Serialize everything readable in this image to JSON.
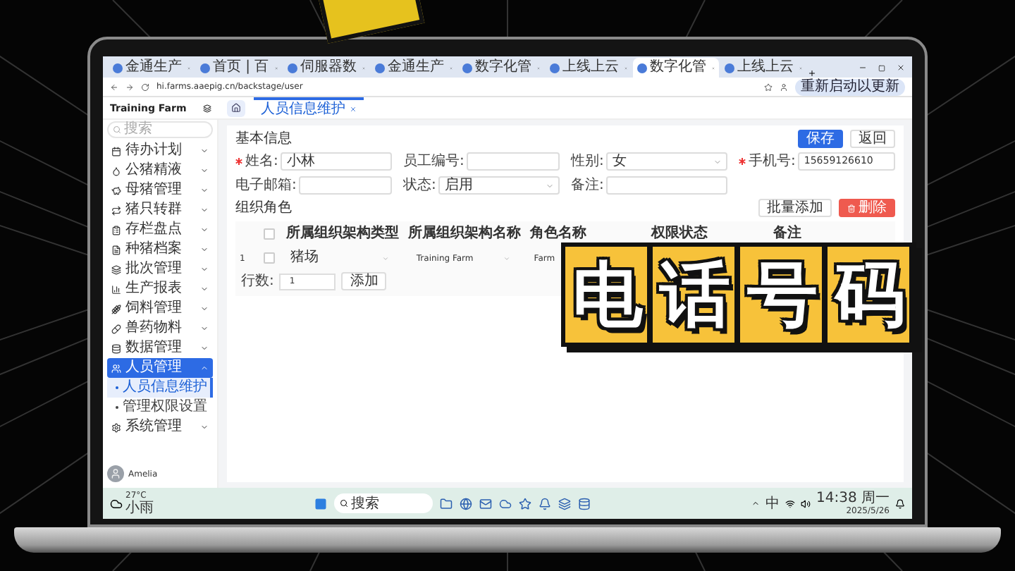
{
  "browser": {
    "tabs": [
      {
        "title": "金通生产",
        "selected": false
      },
      {
        "title": "首页 | 百",
        "selected": false
      },
      {
        "title": "伺服器数",
        "selected": false
      },
      {
        "title": "金通生产",
        "selected": false
      },
      {
        "title": "数字化管",
        "selected": false
      },
      {
        "title": "上线上云",
        "selected": false
      },
      {
        "title": "数字化管",
        "selected": true
      },
      {
        "title": "上线上云",
        "selected": false
      }
    ],
    "url": "hi.farms.aaepig.cn/backstage/user",
    "update_button": "重新启动以更新"
  },
  "app": {
    "brand": "Training Farm",
    "search": {
      "placeholder": "搜索"
    },
    "nav": [
      {
        "label": "待办计划",
        "selected": false,
        "expanded": false
      },
      {
        "label": "公猪精液",
        "selected": false,
        "expanded": false
      },
      {
        "label": "母猪管理",
        "selected": false,
        "expanded": false
      },
      {
        "label": "猪只转群",
        "selected": false,
        "expanded": false
      },
      {
        "label": "存栏盘点",
        "selected": false,
        "expanded": false
      },
      {
        "label": "种猪档案",
        "selected": false,
        "expanded": false
      },
      {
        "label": "批次管理",
        "selected": false,
        "expanded": false
      },
      {
        "label": "生产报表",
        "selected": false,
        "expanded": false
      },
      {
        "label": "饲料管理",
        "selected": false,
        "expanded": false
      },
      {
        "label": "兽药物料",
        "selected": false,
        "expanded": false
      },
      {
        "label": "数据管理",
        "selected": false,
        "expanded": false
      },
      {
        "label": "人员管理",
        "selected": true,
        "expanded": true,
        "children": [
          {
            "label": "人员信息维护",
            "selected": true
          },
          {
            "label": "管理权限设置",
            "selected": false
          }
        ]
      },
      {
        "label": "系统管理",
        "selected": false,
        "expanded": false
      }
    ],
    "user": "Amelia",
    "page_tabs": [
      {
        "label": "人员信息维护",
        "selected": true
      }
    ]
  },
  "form": {
    "section": "基本信息",
    "buttons": [
      {
        "label": "保存",
        "kind": "primary"
      },
      {
        "label": "返回",
        "kind": "default"
      }
    ],
    "fields": [
      {
        "label": "姓名:",
        "required": true,
        "kind": "input",
        "value": "小林"
      },
      {
        "label": "员工编号:",
        "required": false,
        "kind": "input"
      },
      {
        "label": "性别:",
        "required": false,
        "kind": "select",
        "value": "女"
      },
      {
        "label": "手机号:",
        "required": true,
        "kind": "input",
        "value": "15659126610"
      },
      {
        "label": "电子邮箱:",
        "required": false,
        "kind": "input"
      },
      {
        "label": "状态:",
        "required": false,
        "kind": "select",
        "value": "启用"
      },
      {
        "label": "备注:",
        "required": false,
        "kind": "input"
      }
    ]
  },
  "roles": {
    "title": "组织角色",
    "buttons": [
      {
        "label": "批量添加",
        "kind": "default"
      },
      {
        "label": "删除",
        "kind": "danger"
      }
    ],
    "table": {
      "header_checked": false,
      "columns": [
        "所属组织架构类型",
        "所属组织架构名称",
        "角色名称",
        "权限状态",
        "备注"
      ],
      "rows": [
        {
          "index": "1",
          "checked": false,
          "cells": [
            {
              "kind": "select",
              "value": "猪场"
            },
            {
              "kind": "select",
              "value": "Training Farm"
            },
            {
              "kind": "text",
              "value": "Farm"
            }
          ]
        }
      ]
    },
    "rows_label": "行数:",
    "rows_value": "1",
    "add_button": "添加"
  },
  "taskbar": {
    "temperature": "27°C",
    "weather": "小雨",
    "search": {
      "placeholder": "搜索"
    },
    "ime": "中",
    "time": "14:38 周一",
    "date": "2025/5/26"
  },
  "overlay": {
    "caption": "电话号码"
  }
}
